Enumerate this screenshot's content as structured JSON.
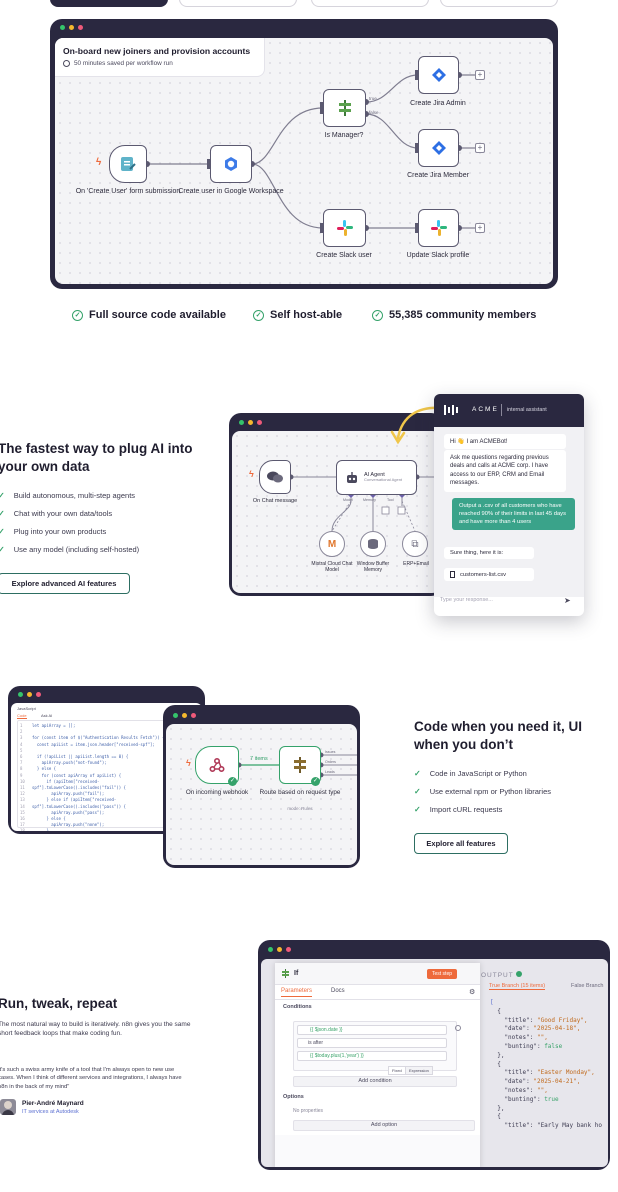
{
  "top_tabs": [
    {
      "active": true
    },
    {
      "active": false
    },
    {
      "active": false
    },
    {
      "active": false
    }
  ],
  "workflow": {
    "title": "On-board new joiners and provision accounts",
    "subtitle": "50 minutes saved per workflow run",
    "nodes": {
      "trigger": "On 'Create User' form submission",
      "google": "Create user in Google Workspace",
      "manager": "Is Manager?",
      "jira_admin": "Create Jira Admin",
      "jira_member": "Create Jira Member",
      "slack_user": "Create Slack user",
      "slack_profile": "Update Slack profile"
    },
    "branch_true": "true",
    "branch_false": "false"
  },
  "features": [
    {
      "label": "Full source code available"
    },
    {
      "label": "Self host-able"
    },
    {
      "label": "55,385 community members"
    }
  ],
  "ai_section": {
    "heading": "The fastest way to plug AI into your own data",
    "bullets": [
      "Build autonomous, multi-step agents",
      "Chat with your own data/tools",
      "Plug into your own products",
      "Use any model (including self-hosted)"
    ],
    "button": "Explore advanced AI features",
    "nodes": {
      "chat": "On Chat message",
      "agent": "AI Agent",
      "agent_sub": "Conversational Agent",
      "mistral": "Mistral Cloud Chat Model",
      "memory": "Window Buffer Memory",
      "erp": "ERP+Email"
    },
    "ports": [
      "Model",
      "Memory",
      "Tool"
    ],
    "chat": {
      "brand": "ACME",
      "brand_sub": "internal assistant",
      "msg1": "Hi 👋 I am ACMEBot!",
      "msg2": "Ask me questions regarding previous deals and calls at ACME corp. I have access to our ERP, CRM and Email messages.",
      "user_msg": "Output a .csv of all customers who have reached 90% of their limits in last 45 days and have more than 4 users",
      "reply": "Sure thing, here it is:",
      "file": "customers-list.csv",
      "input_placeholder": "Type your response..."
    }
  },
  "code_section": {
    "heading": "Code when you need it, UI when you don’t",
    "bullets": [
      "Code in JavaScript or Python",
      "Use external npm or Python libraries",
      "Import cURL requests"
    ],
    "button": "Explore all features",
    "editor": {
      "title": "JavaScript",
      "tab_code": "Code",
      "tab_ask": "Ask AI",
      "lines": [
        "let apiArray = [];",
        "",
        "for (const item of $(\"Authentication Results Fetch\")) {",
        "  const apiList = item.json.header[\"received-spf\"];",
        "",
        "  if (!apiList || apiList.length == 0) {",
        "    apiArray.push(\"not-found\");",
        "  } else {",
        "    for (const apiArray of apiList) {",
        "      if (apiItem[\"received-",
        "spf\"].toLowerCase().includes(\"fail\")) {",
        "        apiArray.push(\"fail\");",
        "      } else if (apiItem[\"received-",
        "spf\"].toLowerCase().includes(\"pass\")) {",
        "        apiArray.push(\"pass\");",
        "      } else {",
        "        apiArray.push(\"none\");",
        "      }",
        "    }"
      ]
    },
    "nodes": {
      "webhook": "On incoming webhook",
      "items": "7 items",
      "router": "Route based on request type",
      "router_sub": "mode: Rules"
    },
    "outputs": [
      "Issues",
      "Orders",
      "Leads"
    ]
  },
  "run_section": {
    "heading": "Run, tweak, repeat",
    "paragraph": "The most natural way to build is iteratively. n8n gives you the same short feedback loops that make coding fun.",
    "quote": "It's such a swiss army knife of a tool that I'm always open to new use cases. When I think of different services and integrations, I always have n8n in the back of my mind\"",
    "author": "Pier-André Maynard",
    "author_role": "IT services at Autodesk",
    "panel": {
      "node_title": "If",
      "test_button": "Test step",
      "tab_params": "Parameters",
      "tab_docs": "Docs",
      "conditions_label": "Conditions",
      "expr1": "{{ $json.date }}",
      "operator": "is after",
      "expr2": "{{ $today.plus(1,'year') }}",
      "fixed": "Fixed",
      "expression": "Expression",
      "add_condition": "Add condition",
      "options_label": "Options",
      "no_props": "No properties",
      "add_option": "Add option",
      "output_label": "OUTPUT",
      "output_tab1": "True Branch (15 items)",
      "output_tab2": "False Branch",
      "json": [
        {
          "title": "Good Friday",
          "date": "2025-04-18",
          "notes": "\"\"",
          "bunting": "false"
        },
        {
          "title": "Easter Monday",
          "date": "2025-04-21",
          "notes": "\"\"",
          "bunting": "true"
        }
      ],
      "json_tail": "\"title\": \"Early May bank ho"
    }
  },
  "colors": {
    "dark_frame": "#2a2840",
    "accent_green": "#35a26a",
    "accent_orange": "#ee6a3c",
    "chat_user_bubble": "#3aa38a",
    "json_key": "#3e3c52",
    "json_string": "#c0691b",
    "json_bool": "#3aa36a"
  },
  "icons": [
    "lightning-icon",
    "form-icon",
    "google-icon",
    "router-icon",
    "jira-icon",
    "slack-icon",
    "plus-icon",
    "check-icon",
    "clock-icon",
    "chat-icon",
    "robot-icon",
    "webhook-icon",
    "file-icon",
    "send-icon",
    "gear-icon"
  ]
}
